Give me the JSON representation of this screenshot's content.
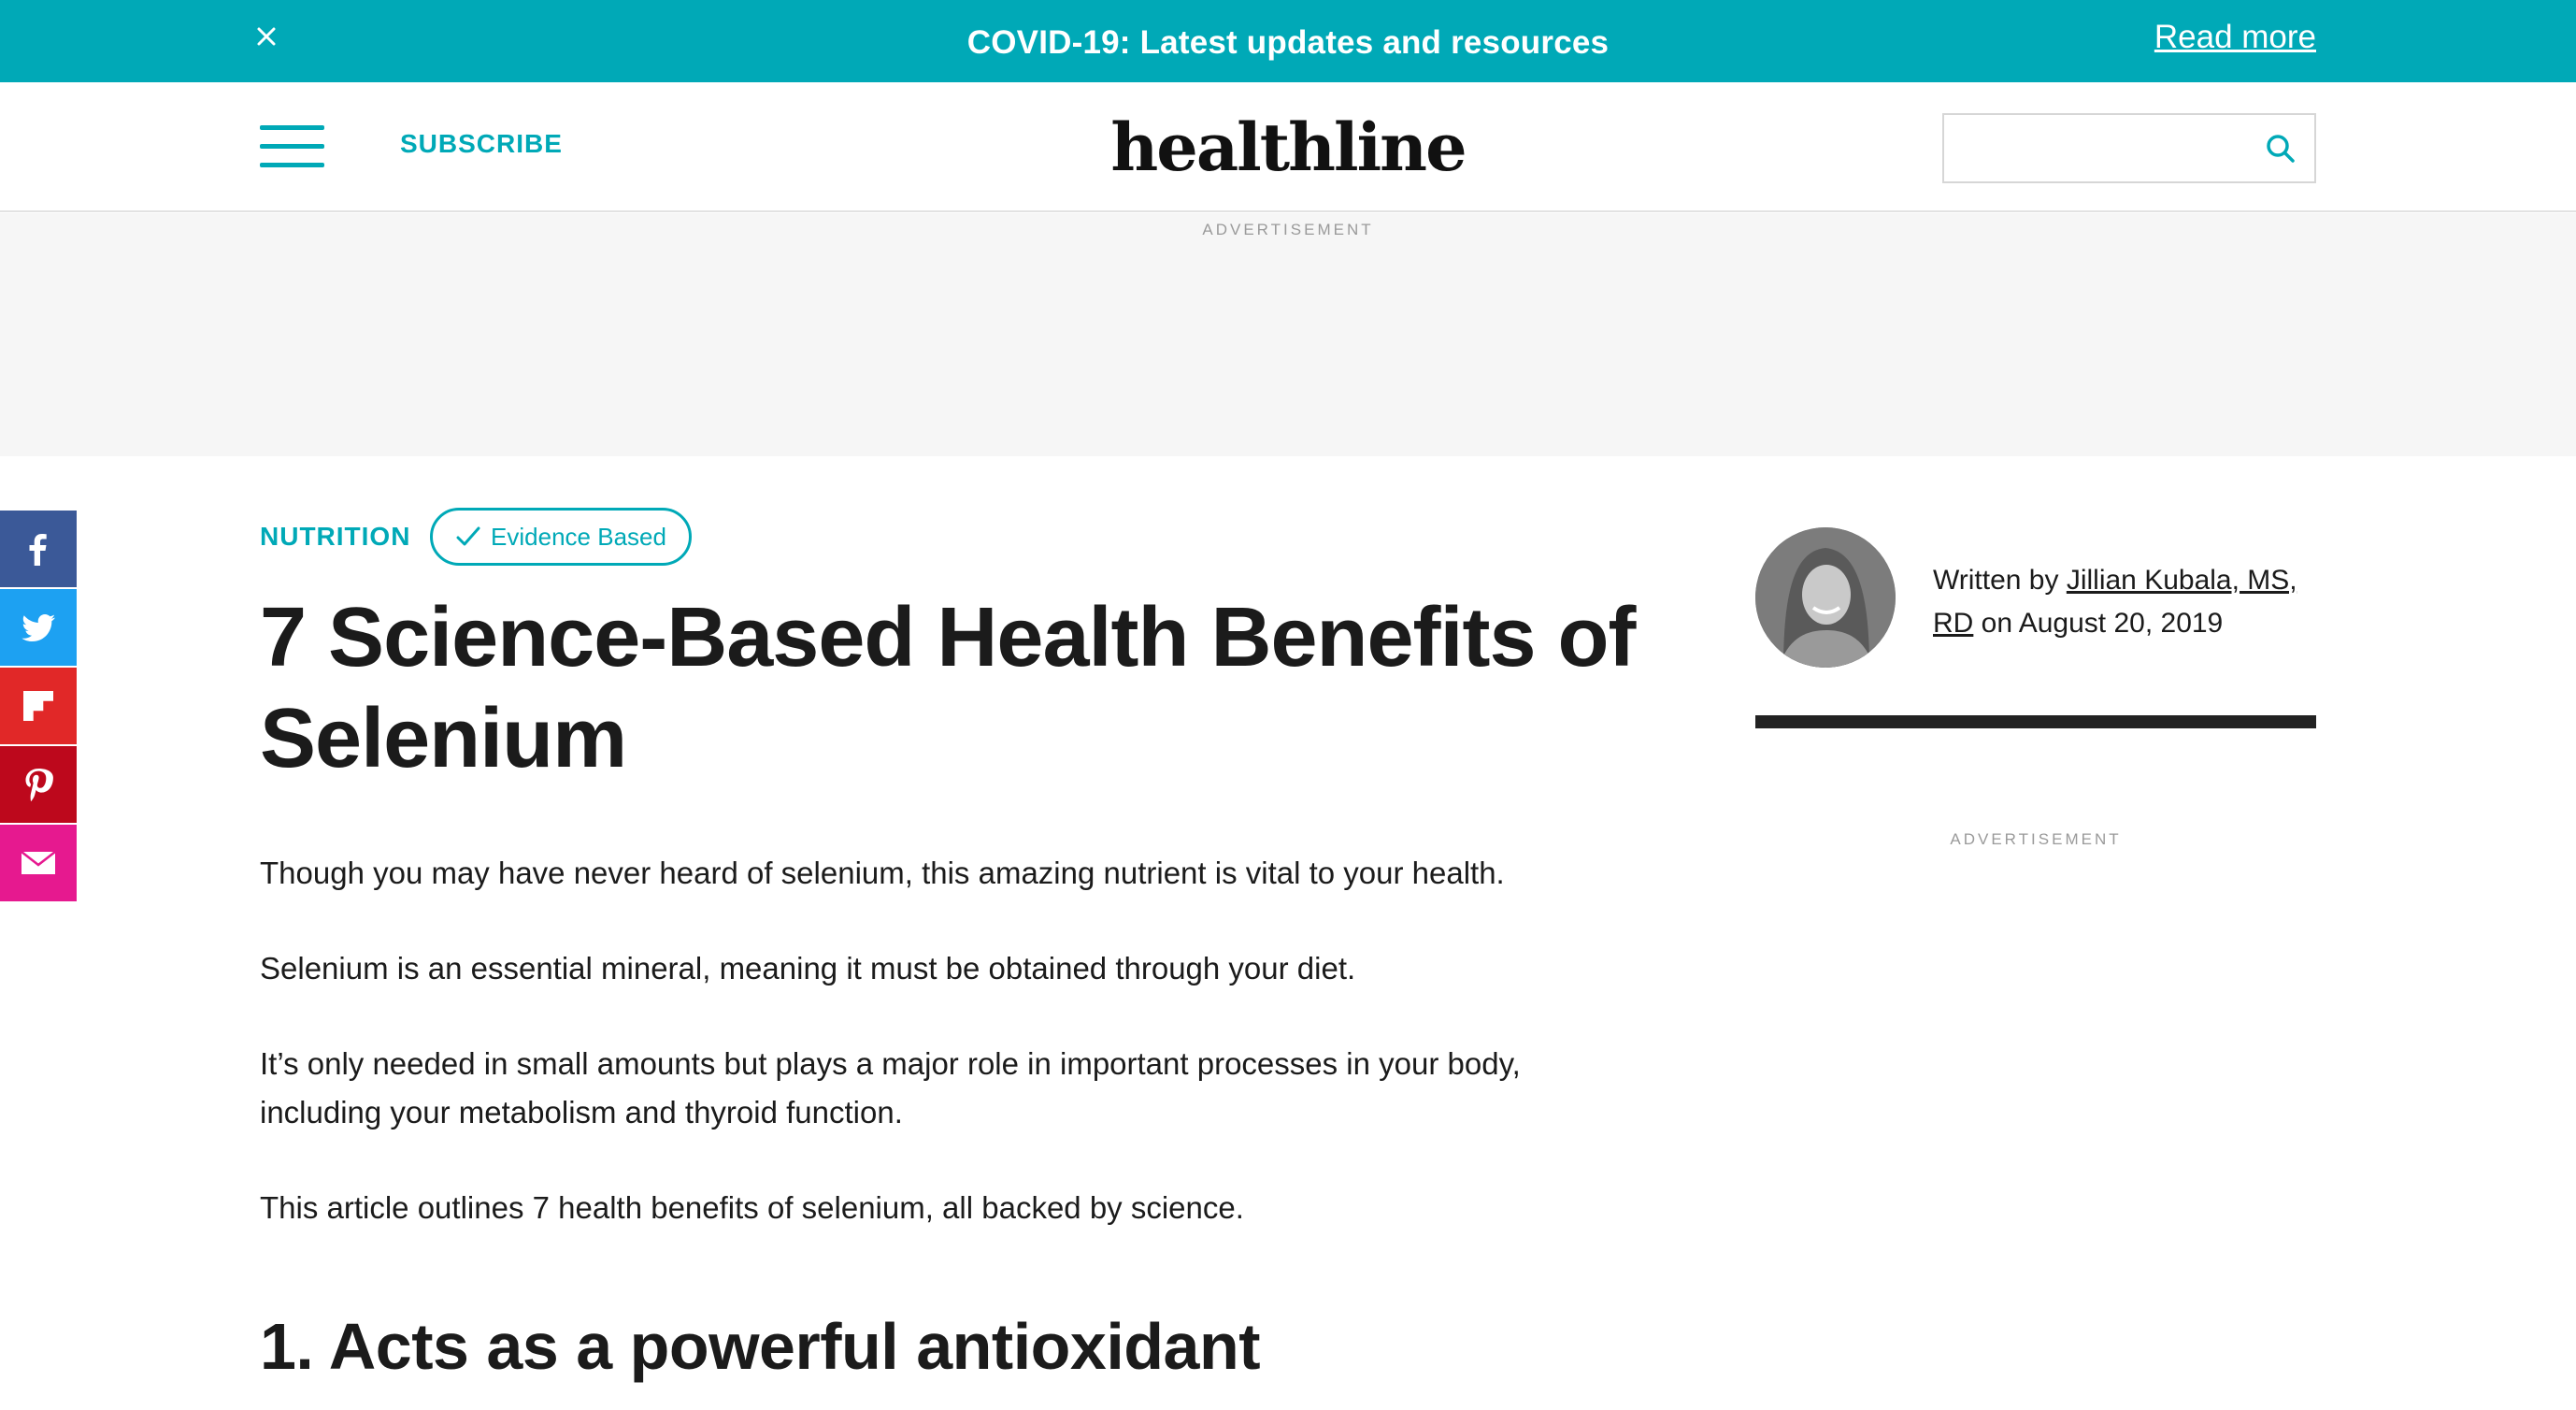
{
  "banner": {
    "text": "COVID-19: Latest updates and resources",
    "link_label": "Read more",
    "close_icon": "close-icon",
    "bg_color": "#00a9b7"
  },
  "header": {
    "subscribe_label": "SUBSCRIBE",
    "logo_text": "healthline",
    "search_placeholder": "",
    "menu_icon": "hamburger-menu-icon",
    "search_icon": "search-icon"
  },
  "ads": {
    "top_label": "ADVERTISEMENT",
    "sidebar_label": "ADVERTISEMENT"
  },
  "social": [
    {
      "name": "facebook",
      "icon": "facebook-icon",
      "color": "#3b5998"
    },
    {
      "name": "twitter",
      "icon": "twitter-icon",
      "color": "#1da1f2"
    },
    {
      "name": "flipboard",
      "icon": "flipboard-icon",
      "color": "#e12828"
    },
    {
      "name": "pinterest",
      "icon": "pinterest-icon",
      "color": "#bd081c"
    },
    {
      "name": "email",
      "icon": "email-icon",
      "color": "#e6198f"
    }
  ],
  "article": {
    "category": "NUTRITION",
    "badge_label": "Evidence Based",
    "title": "7 Science-Based Health Benefits of Selenium",
    "paragraphs": [
      "Though you may have never heard of selenium, this amazing nutrient is vital to your health.",
      "Selenium is an essential mineral, meaning it must be obtained through your diet.",
      "It’s only needed in small amounts but plays a major role in important processes in your body, including your metabolism and thyroid function.",
      "This article outlines 7 health benefits of selenium, all backed by science."
    ],
    "section_heading": "1. Acts as a powerful antioxidant"
  },
  "author": {
    "prefix": "Written by ",
    "name": "Jillian Kubala, MS, RD",
    "date_prefix": " on ",
    "date": "August 20, 2019"
  },
  "colors": {
    "accent": "#00a9b7",
    "text": "#1b1b1b"
  }
}
